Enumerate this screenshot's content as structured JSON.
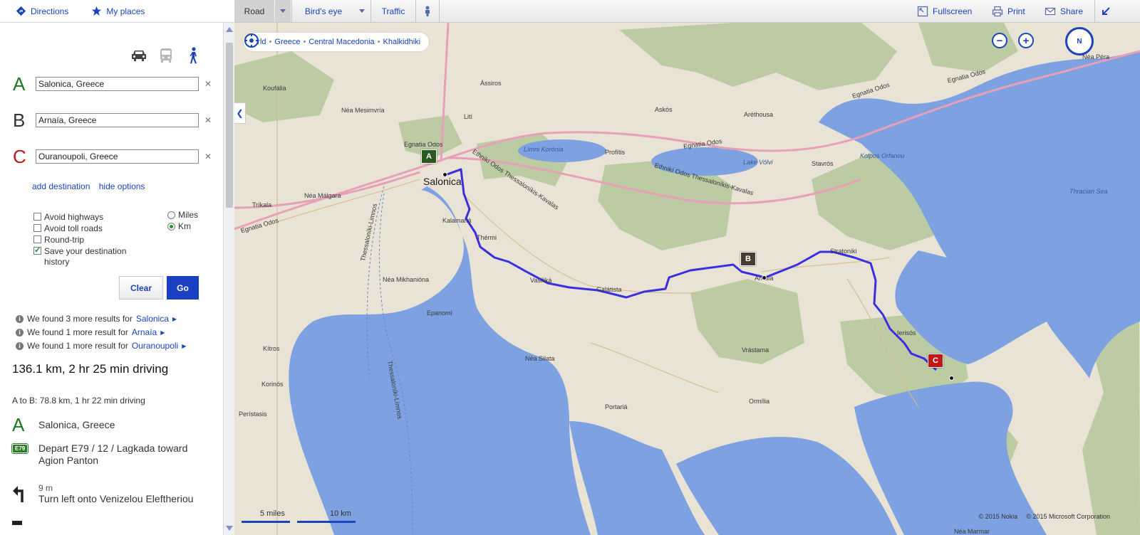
{
  "header": {
    "directions_label": "Directions",
    "my_places_label": "My places"
  },
  "toolbar": {
    "road": "Road",
    "birds_eye": "Bird's eye",
    "traffic": "Traffic",
    "fullscreen": "Fullscreen",
    "print": "Print",
    "share": "Share"
  },
  "travel_modes": [
    "car-icon",
    "bus-icon",
    "walk-icon"
  ],
  "waypoints": [
    {
      "letter": "A",
      "color": "#1e7a1e",
      "value": "Salonica, Greece"
    },
    {
      "letter": "B",
      "color": "#333333",
      "value": "Arnaía, Greece"
    },
    {
      "letter": "C",
      "color": "#c01818",
      "value": "Ouranoupoli, Greece"
    }
  ],
  "options": {
    "add_destination": "add destination",
    "hide_options": "hide options",
    "avoid_highways": "Avoid highways",
    "avoid_tolls": "Avoid toll roads",
    "round_trip": "Round-trip",
    "save_history_1": "Save your destination",
    "save_history_2": "history",
    "save_history_checked": true,
    "miles": "Miles",
    "km": "Km",
    "unit_selected": "Km"
  },
  "buttons": {
    "clear": "Clear",
    "go": "Go"
  },
  "results": [
    {
      "text": "We found 3 more results for",
      "place": "Salonica"
    },
    {
      "text": "We found 1 more result for",
      "place": "Arnaía"
    },
    {
      "text": "We found 1 more result for",
      "place": "Ouranoupoli"
    }
  ],
  "summary": {
    "total": "136.1 km, 2 hr 25 min driving",
    "leg": "A to B: 78.8 km, 1 hr 22 min driving"
  },
  "steps": [
    {
      "icon": "waypoint-a-icon",
      "text": "Salonica, Greece"
    },
    {
      "icon": "highway-e79-icon",
      "badge": "E79",
      "text": "Depart E79 / 12 / Lagkada toward Agion Panton"
    },
    {
      "icon": "turn-left-icon",
      "distance": "9 m",
      "text": "Turn left onto Venizelou Eleftheriou"
    }
  ],
  "map": {
    "breadcrumb": [
      "World",
      "Greece",
      "Central Macedonia",
      "Khalkidhiki"
    ],
    "zoom_out": "−",
    "zoom_in": "+",
    "compass": "N",
    "scale_miles": "5 miles",
    "scale_km": "10 km",
    "copyright": [
      "© 2015 Nokia",
      "© 2015 Microsoft Corporation"
    ],
    "colors": {
      "land": "#e9e3d5",
      "water": "#7ea2e1",
      "forest": "#b4c79a",
      "route": "#3a2ee0",
      "highway": "#e8a0b8"
    },
    "markers": [
      {
        "letter": "A",
        "color": "#2a5a1e"
      },
      {
        "letter": "B",
        "color": "#4a3a30"
      },
      {
        "letter": "C",
        "color": "#c01818"
      }
    ],
    "labels": {
      "salonica": "Salonica",
      "kalamaria": "Kalamariá",
      "thermi": "Thérmi",
      "vasilika": "Vasiliká",
      "galatista": "Galátista",
      "arnaia": "Arnaía",
      "stratoniki": "Stratoniki",
      "ierissos": "Ierisós",
      "vrastama": "Vrástama",
      "ormilia": "Ormília",
      "portaria": "Portariá",
      "nea_silata": "Néa Silata",
      "epanomi": "Epanomí",
      "nea_mikhaniona": "Néa Mikhanióna",
      "nea_malgara": "Néa Málgara",
      "trikala": "Tríkala",
      "kitros": "Kítros",
      "koronos": "Korinós",
      "peristasis": "Perístasis",
      "koufalia": "Koufália",
      "nea_mesimvria": "Néa Mesimvría",
      "lito": "Lití",
      "assiros": "Ássiros",
      "askos": "Askós",
      "arethousa": "Aréthousa",
      "profitis": "Profítis",
      "stavros": "Stavrós",
      "nea_peramos": "Néa Péra",
      "limni_koroneia": "Límni Korónia",
      "lake_volvi": "Lake Vólvi",
      "kolpos_orfanou": "Kolpos Orfanou",
      "thracian_sea": "Thracian Sea",
      "egnatia_1": "Egnatia Odos",
      "egnatia_2": "Egnatia Odos",
      "egnatia_3": "Egnatia Odos",
      "egnatia_4": "Egnatia Odos",
      "egnatia_5": "Egnatia Odos",
      "ethniki_1": "Ethnikí Odos Thessaloníkis-Kavalas",
      "ethniki_2": "Ethnikí Odos Thessaloníkis-Kavalas",
      "thess_lim_1": "Thessaloníki-Limnos",
      "thess_lim_2": "Thessaloníki-Límnos",
      "nea_marmar": "Néa Marmar"
    }
  }
}
